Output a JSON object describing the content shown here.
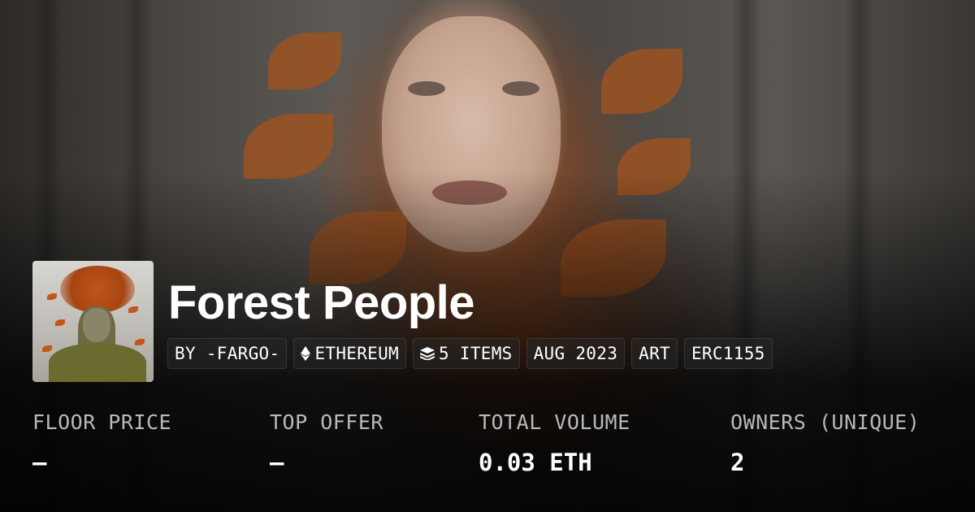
{
  "collection": {
    "title": "Forest People",
    "tags": [
      {
        "icon": "none",
        "label": "BY -FARGO-"
      },
      {
        "icon": "ethereum-icon",
        "label": "ETHEREUM"
      },
      {
        "icon": "layers-icon",
        "label": "5 ITEMS"
      },
      {
        "icon": "none",
        "label": "AUG 2023"
      },
      {
        "icon": "none",
        "label": "ART"
      },
      {
        "icon": "none",
        "label": "ERC1155"
      }
    ]
  },
  "stats": [
    {
      "label": "FLOOR PRICE",
      "value": "–"
    },
    {
      "label": "TOP OFFER",
      "value": "–"
    },
    {
      "label": "TOTAL VOLUME",
      "value": "0.03 ETH"
    },
    {
      "label": "OWNERS (UNIQUE)",
      "value": "2"
    }
  ],
  "colors": {
    "title": "#ffffff",
    "stat_label": "#b9b9b9",
    "tag_bg": "#282828"
  }
}
